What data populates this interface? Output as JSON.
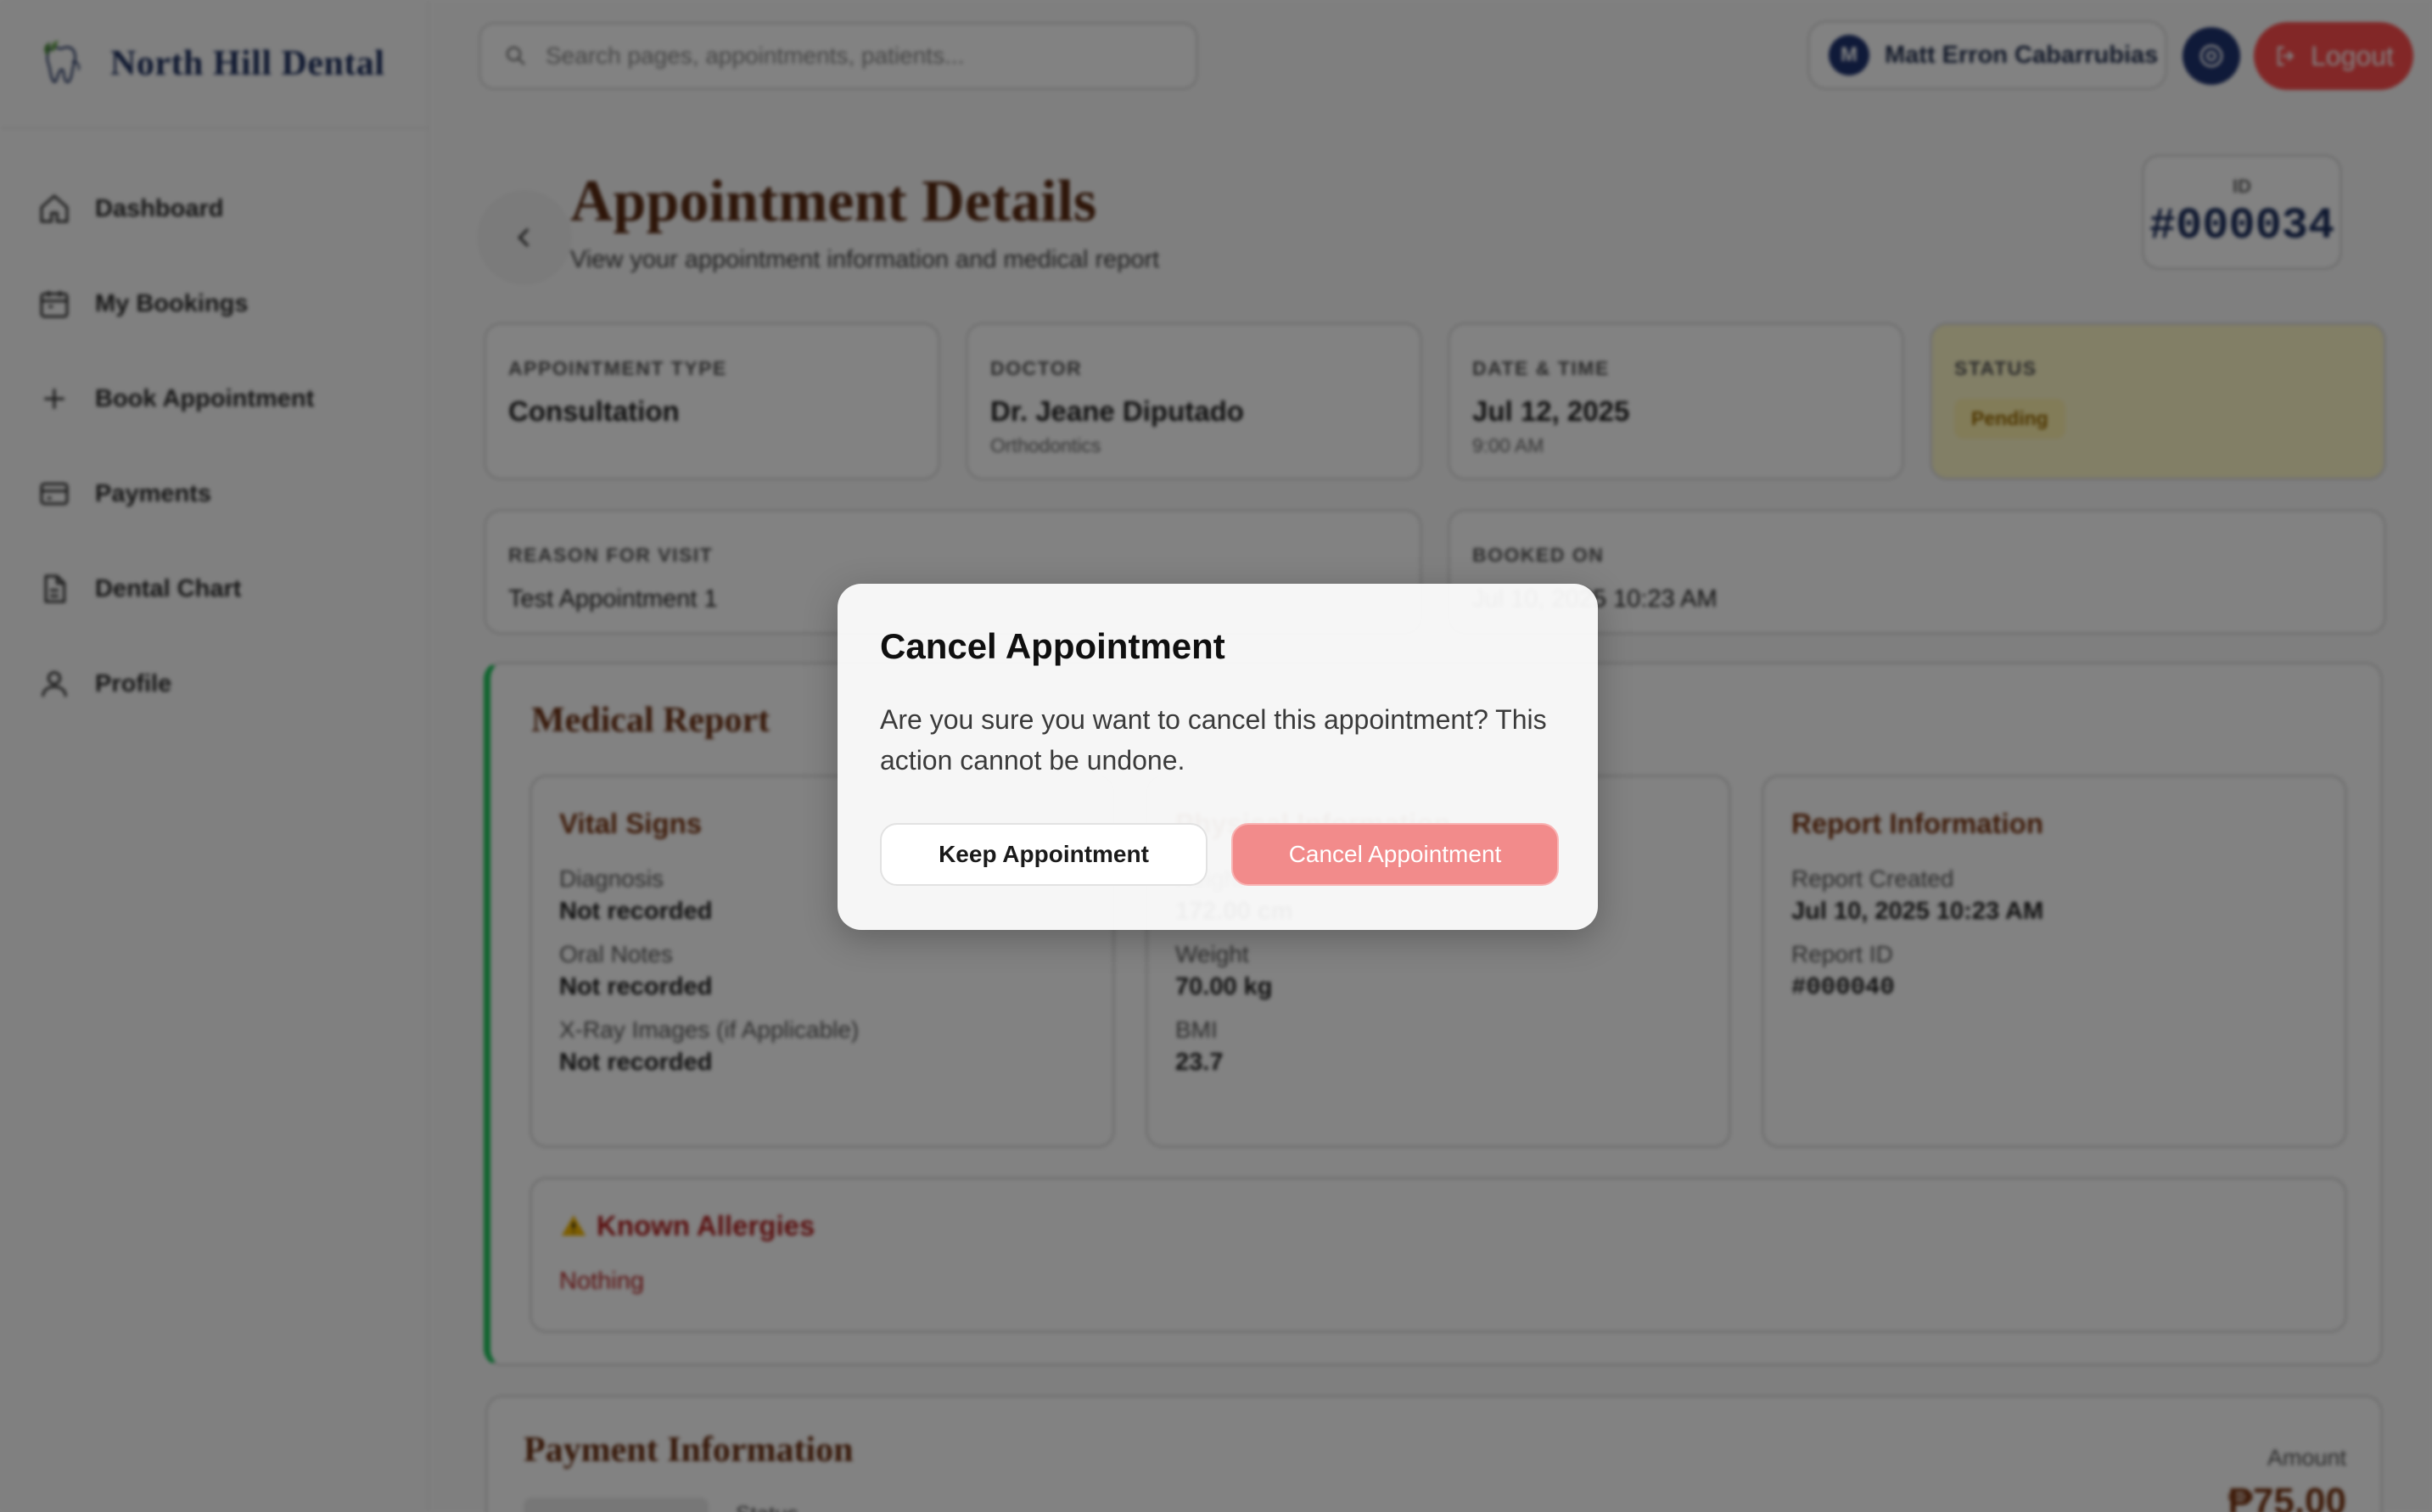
{
  "brand": {
    "name": "North Hill Dental"
  },
  "sidebar": {
    "items": [
      {
        "label": "Dashboard",
        "icon": "home-icon"
      },
      {
        "label": "My Bookings",
        "icon": "calendar-icon"
      },
      {
        "label": "Book Appointment",
        "icon": "plus-icon"
      },
      {
        "label": "Payments",
        "icon": "credit-card-icon"
      },
      {
        "label": "Dental Chart",
        "icon": "document-icon"
      },
      {
        "label": "Profile",
        "icon": "user-icon"
      }
    ]
  },
  "header": {
    "search_placeholder": "Search pages, appointments, patients...",
    "user_initial": "M",
    "user_name": "Matt Erron Cabarrubias",
    "logout_label": "Logout"
  },
  "page": {
    "title": "Appointment Details",
    "subtitle": "View your appointment information and medical report",
    "id_label": "ID",
    "id_value": "#000034"
  },
  "summary": {
    "type_label": "APPOINTMENT TYPE",
    "type_value": "Consultation",
    "doctor_label": "DOCTOR",
    "doctor_name": "Dr. Jeane Diputado",
    "doctor_specialty": "Orthodontics",
    "datetime_label": "DATE & TIME",
    "date": "Jul 12, 2025",
    "time": "9:00 AM",
    "status_label": "STATUS",
    "status_value": "Pending",
    "reason_label": "REASON FOR VISIT",
    "reason_value": "Test Appointment 1",
    "booked_label": "BOOKED ON",
    "booked_value": "Jul 10, 2025 10:23 AM"
  },
  "medical_report": {
    "title": "Medical Report",
    "vitals": {
      "title": "Vital Signs",
      "fields": [
        {
          "label": "Diagnosis",
          "value": "Not recorded"
        },
        {
          "label": "Oral Notes",
          "value": "Not recorded"
        },
        {
          "label": "X-Ray Images (if Applicable)",
          "value": "Not recorded"
        }
      ]
    },
    "physical": {
      "title": "Physical Information",
      "fields": [
        {
          "label": "Height",
          "value": "172.00 cm"
        },
        {
          "label": "Weight",
          "value": "70.00 kg"
        },
        {
          "label": "BMI",
          "value": "23.7"
        }
      ]
    },
    "report_info": {
      "title": "Report Information",
      "fields": [
        {
          "label": "Report Created",
          "value": "Jul 10, 2025 10:23 AM"
        },
        {
          "label": "Report ID",
          "value": "#000040"
        }
      ]
    },
    "allergies": {
      "title": "Known Allergies",
      "value": "Nothing"
    }
  },
  "payment": {
    "title": "Payment Information",
    "amount_label": "Amount",
    "amount_value": "₱75.00",
    "status_label": "Status"
  },
  "modal": {
    "title": "Cancel Appointment",
    "message": "Are you sure you want to cancel this appointment? This action cannot be undone.",
    "keep_label": "Keep Appointment",
    "confirm_label": "Cancel Appointment"
  },
  "colors": {
    "brand_navy": "#1d2f5e",
    "title_brown": "#5a2a12",
    "danger": "#ff4d4d",
    "confirm_button": "#f28b8b",
    "report_accent": "#22c55e",
    "status_pending_bg": "#fff9c9"
  }
}
